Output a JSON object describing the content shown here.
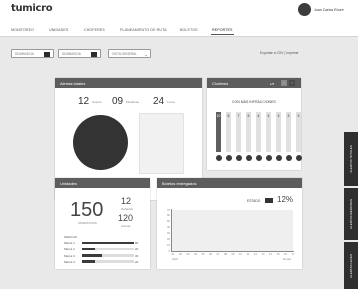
{
  "app": {
    "logo": "tumicro"
  },
  "user": {
    "name": "Juan Carlos Ríos",
    "caret": "▾"
  },
  "nav": {
    "items": [
      {
        "label": "MONITOREO"
      },
      {
        "label": "UNIDADES"
      },
      {
        "label": "CHOFERES"
      },
      {
        "label": "PLANEAMIENTO DE RUTA"
      },
      {
        "label": "BOLETOS"
      },
      {
        "label": "REPORTES"
      }
    ],
    "active": "REPORTES"
  },
  "filters": {
    "date_from": "DD/MM/2016",
    "date_to": "DD/MM/2016",
    "view_select": "VISTA GENERAL",
    "export_links": "Exportar a CSV | Imprimir"
  },
  "alertas": {
    "title": "Alertas totales",
    "kpis": [
      {
        "value": "12",
        "label": "Graves"
      },
      {
        "value": "09",
        "label": "Medianas"
      },
      {
        "value": "24",
        "label": "Leves"
      }
    ]
  },
  "choferes": {
    "title": "Choferes",
    "pager": "1/5",
    "prev_icon": "‹",
    "next_icon": "›",
    "subtitle": "CON MÁS INFRACCIONES",
    "colors": {
      "highlight": "#5f5f5f",
      "normal": "#e0e0e0"
    },
    "values": [
      {
        "value": "10",
        "highlight": true
      },
      {
        "value": "8",
        "highlight": false
      },
      {
        "value": "7",
        "highlight": false
      },
      {
        "value": "5",
        "highlight": false
      },
      {
        "value": "4",
        "highlight": false
      },
      {
        "value": "4",
        "highlight": false
      },
      {
        "value": "3",
        "highlight": false
      },
      {
        "value": "3",
        "highlight": false
      },
      {
        "value": "3",
        "highlight": false
      }
    ]
  },
  "unidades": {
    "title": "Unidades",
    "total": "150",
    "total_label": "OPERATIVAS",
    "secondary": [
      {
        "value": "12",
        "label": "Dañadas"
      },
      {
        "value": "120",
        "label": "Activas"
      }
    ],
    "brands_title": "MARCAS",
    "brands": [
      {
        "label": "Marca 1",
        "value": 80
      },
      {
        "label": "Marca 2",
        "value": 20
      },
      {
        "label": "Marca 3",
        "value": 30
      },
      {
        "label": "Marca 4",
        "value": 20
      }
    ],
    "brand_max": 80
  },
  "boletos": {
    "title": "Boletos entregados",
    "estado_label": "ESTADO",
    "estado_pct": "12%",
    "y_ticks": [
      "70",
      "60",
      "50",
      "40",
      "30",
      "20",
      "10",
      "0"
    ],
    "x_ticks": [
      "01",
      "02",
      "03",
      "04",
      "05",
      "06",
      "07",
      "08",
      "09",
      "10",
      "11",
      "12",
      "13",
      "14",
      "15",
      "16",
      "17"
    ],
    "x_start_label": "Abril",
    "x_end_label": "Horas"
  },
  "side_tabs": [
    {
      "label": "ALERTAS TOTALES"
    },
    {
      "label": "ALERTAS MEDIANAS"
    },
    {
      "label": "ALERTAS LEVES"
    }
  ]
}
